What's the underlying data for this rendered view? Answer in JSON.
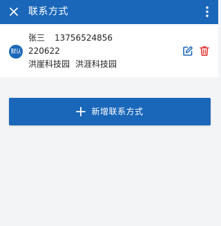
{
  "appbar": {
    "title": "联系方式",
    "close_icon": "close-icon",
    "more_icon": "more-vertical-icon",
    "background": "#1a67b9"
  },
  "contact": {
    "badge": "默认",
    "name": "张三",
    "phone": "13756524856",
    "code": "220622",
    "address_1": "洪崖科技园",
    "address_2": "洪涯科技园",
    "edit_icon": "edit-icon",
    "delete_icon": "trash-icon",
    "delete_color": "#e53935"
  },
  "add_button": {
    "label": "新增联系方式",
    "icon": "plus-icon"
  }
}
